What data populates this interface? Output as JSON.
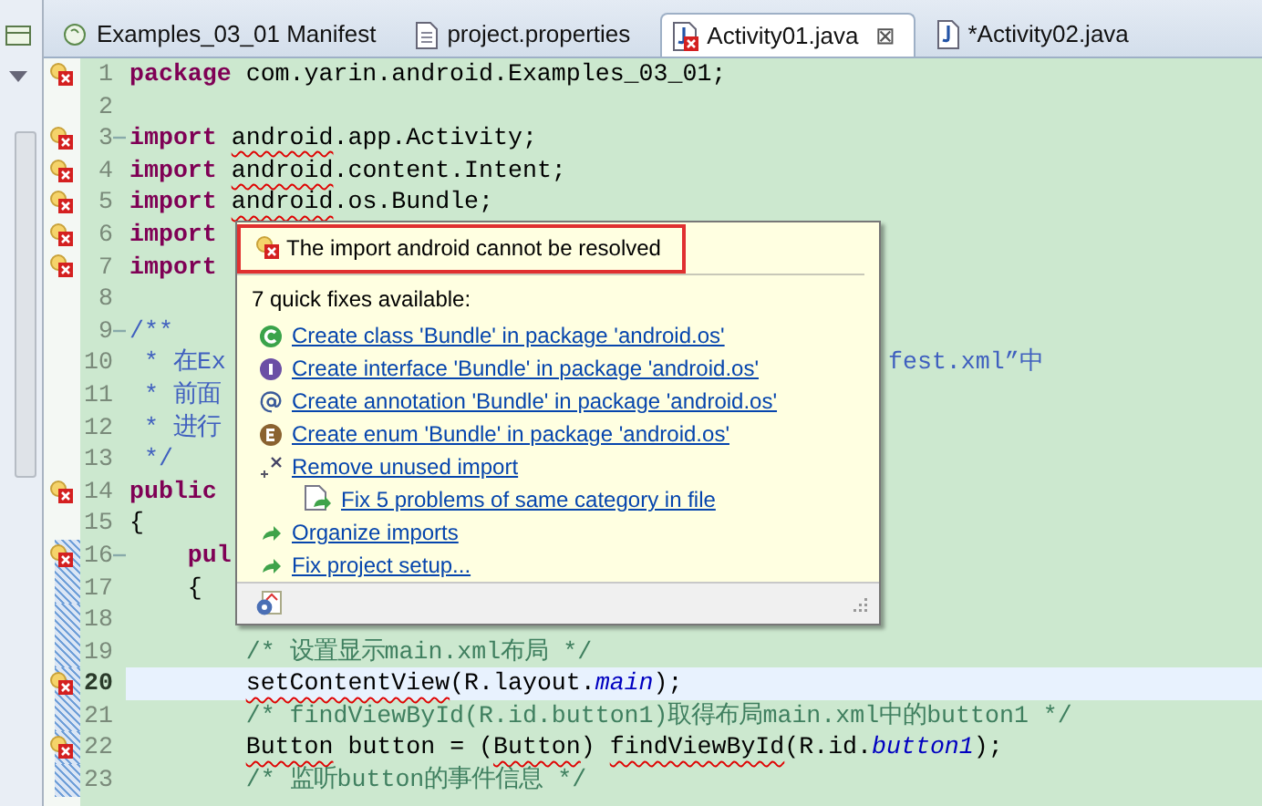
{
  "tabs": [
    {
      "label": "Examples_03_01 Manifest",
      "kind": "manifest",
      "selected": false
    },
    {
      "label": "project.properties",
      "kind": "properties",
      "selected": false
    },
    {
      "label": "Activity01.java",
      "kind": "java-error",
      "selected": true,
      "close": "⊠"
    },
    {
      "label": "*Activity02.java",
      "kind": "java",
      "selected": false
    }
  ],
  "editor": {
    "lines": [
      {
        "number": "1",
        "error": true,
        "fold": false,
        "changed": false,
        "current": false,
        "segments": [
          {
            "kind": "keyword",
            "text": "package"
          },
          {
            "kind": "plain",
            "text": " com.yarin.android.Examples_03_01;"
          }
        ]
      },
      {
        "number": "2",
        "error": false,
        "fold": false,
        "changed": false,
        "current": false
      },
      {
        "number": "3",
        "error": true,
        "fold": true,
        "changed": false,
        "current": false,
        "segments": [
          {
            "kind": "keyword",
            "text": "import"
          },
          {
            "kind": "plain",
            "text": " android",
            "error": true
          },
          {
            "kind": "plain",
            "text": ".app.Activity;"
          }
        ]
      },
      {
        "number": "4",
        "error": true,
        "fold": false,
        "changed": false,
        "current": false,
        "segments": [
          {
            "kind": "keyword",
            "text": "import"
          },
          {
            "kind": "plain",
            "text": " android",
            "error": true
          },
          {
            "kind": "plain",
            "text": ".content.Intent;"
          }
        ]
      },
      {
        "number": "5",
        "error": true,
        "fold": false,
        "changed": false,
        "current": false,
        "segments": [
          {
            "kind": "keyword",
            "text": "import"
          },
          {
            "kind": "plain",
            "text": " android",
            "error": true
          },
          {
            "kind": "plain",
            "text": ".os.Bundle;"
          }
        ]
      },
      {
        "number": "6",
        "error": true,
        "fold": false,
        "changed": false,
        "current": false,
        "segments": [
          {
            "kind": "keyword",
            "text": "import"
          }
        ]
      },
      {
        "number": "7",
        "error": true,
        "fold": false,
        "changed": false,
        "current": false,
        "segments": [
          {
            "kind": "keyword",
            "text": "import"
          }
        ]
      },
      {
        "number": "8",
        "error": false,
        "fold": false,
        "changed": false,
        "current": false
      },
      {
        "number": "9",
        "error": false,
        "fold": true,
        "changed": false,
        "current": false,
        "segments": [
          {
            "kind": "javadoc",
            "text": "/**"
          }
        ]
      },
      {
        "number": "10",
        "error": false,
        "fold": false,
        "changed": false,
        "current": false,
        "segments": [
          {
            "kind": "javadoc",
            "text": " * 在Ex"
          },
          {
            "kind": "javadoc",
            "text": "fest.xml”中",
            "after_popup": true
          }
        ]
      },
      {
        "number": "11",
        "error": false,
        "fold": false,
        "changed": false,
        "current": false,
        "segments": [
          {
            "kind": "javadoc",
            "text": " * 前面"
          }
        ]
      },
      {
        "number": "12",
        "error": false,
        "fold": false,
        "changed": false,
        "current": false,
        "segments": [
          {
            "kind": "javadoc",
            "text": " * 进行"
          }
        ]
      },
      {
        "number": "13",
        "error": false,
        "fold": false,
        "changed": false,
        "current": false,
        "segments": [
          {
            "kind": "javadoc",
            "text": " */"
          }
        ]
      },
      {
        "number": "14",
        "error": true,
        "fold": false,
        "changed": false,
        "current": false,
        "segments": [
          {
            "kind": "keyword",
            "text": "public"
          }
        ]
      },
      {
        "number": "15",
        "error": false,
        "fold": false,
        "changed": false,
        "current": false,
        "segments": [
          {
            "kind": "plain",
            "text": "{"
          }
        ]
      },
      {
        "number": "16",
        "error": true,
        "fold": true,
        "changed": true,
        "current": false,
        "segments": [
          {
            "kind": "keyword",
            "text": "    pul"
          }
        ]
      },
      {
        "number": "17",
        "error": false,
        "fold": false,
        "changed": true,
        "current": false,
        "segments": [
          {
            "kind": "plain",
            "text": "    {"
          }
        ]
      },
      {
        "number": "18",
        "error": false,
        "fold": false,
        "changed": true,
        "current": false
      },
      {
        "number": "19",
        "error": false,
        "fold": false,
        "changed": true,
        "current": false,
        "segments": [
          {
            "kind": "comment",
            "text": "        /* 设置显示main.xml布局 */"
          }
        ]
      },
      {
        "number": "20",
        "error": true,
        "fold": false,
        "changed": true,
        "current": true,
        "segments": [
          {
            "kind": "plain",
            "text": "        setContentView",
            "error": true
          },
          {
            "kind": "plain",
            "text": "(R.layout."
          },
          {
            "kind": "field",
            "text": "main"
          },
          {
            "kind": "plain",
            "text": ");"
          }
        ]
      },
      {
        "number": "21",
        "error": false,
        "fold": false,
        "changed": true,
        "current": false,
        "segments": [
          {
            "kind": "comment",
            "text": "        /* findViewById(R.id.button1)取得布局main.xml中的button1 */"
          }
        ]
      },
      {
        "number": "22",
        "error": true,
        "fold": false,
        "changed": true,
        "current": false,
        "segments": [
          {
            "kind": "plain",
            "text": "        Button",
            "error": true
          },
          {
            "kind": "plain",
            "text": " button = ("
          },
          {
            "kind": "plain",
            "text": "Button",
            "error": true
          },
          {
            "kind": "plain",
            "text": ") "
          },
          {
            "kind": "plain",
            "text": "findViewById",
            "error": true
          },
          {
            "kind": "plain",
            "text": "(R.id."
          },
          {
            "kind": "field",
            "text": "button1"
          },
          {
            "kind": "plain",
            "text": ");"
          }
        ]
      },
      {
        "number": "23",
        "error": false,
        "fold": false,
        "changed": true,
        "current": false,
        "segments": [
          {
            "kind": "comment",
            "text": "        /* 监听button的事件信息 */"
          }
        ]
      }
    ]
  },
  "quick_fix_popup": {
    "message": "The import android cannot be resolved",
    "highlighted": true,
    "count_label": "7 quick fixes available:",
    "fixes": [
      {
        "kind": "class",
        "label": "Create class 'Bundle' in package 'android.os'"
      },
      {
        "kind": "interface",
        "label": "Create interface 'Bundle' in package 'android.os'"
      },
      {
        "kind": "annotation",
        "label": "Create annotation 'Bundle' in package 'android.os'"
      },
      {
        "kind": "enum",
        "label": "Create enum 'Bundle' in package 'android.os'"
      },
      {
        "kind": "remove",
        "label": "Remove unused import",
        "children": [
          {
            "kind": "multi",
            "label": "Fix 5 problems of same category in file"
          }
        ]
      },
      {
        "kind": "action",
        "label": "Organize imports"
      },
      {
        "kind": "action",
        "label": "Fix project setup..."
      }
    ]
  }
}
